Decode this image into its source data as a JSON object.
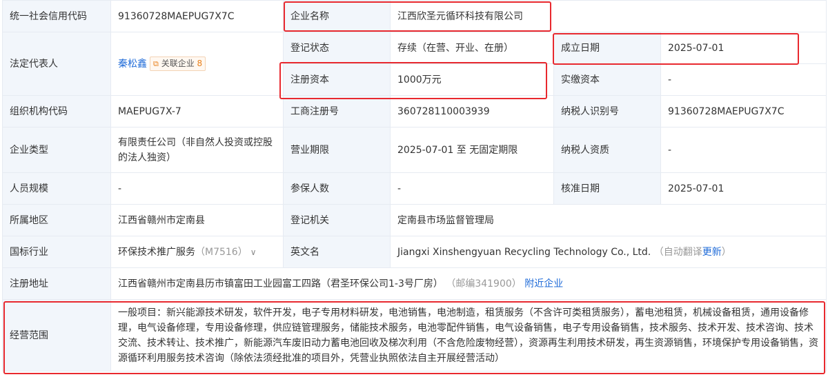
{
  "rows": {
    "credit_code": {
      "label": "统一社会信用代码",
      "value": "91360728MAEPUG7X7C"
    },
    "company_name": {
      "label": "企业名称",
      "value": "江西欣圣元循环科技有限公司"
    },
    "legal_rep": {
      "label": "法定代表人",
      "name": "秦松鑫",
      "tag_label": "关联企业",
      "tag_count": "8"
    },
    "reg_status": {
      "label": "登记状态",
      "value": "存续（在营、开业、在册）"
    },
    "est_date": {
      "label": "成立日期",
      "value": "2025-07-01"
    },
    "reg_capital": {
      "label": "注册资本",
      "value": "1000万元"
    },
    "paid_capital": {
      "label": "实缴资本",
      "value": "-"
    },
    "org_code": {
      "label": "组织机构代码",
      "value": "MAEPUG7X-7"
    },
    "biz_reg_no": {
      "label": "工商注册号",
      "value": "360728110003939"
    },
    "taxpayer_id": {
      "label": "纳税人识别号",
      "value": "91360728MAEPUG7X7C"
    },
    "company_type": {
      "label": "企业类型",
      "value": "有限责任公司（非自然人投资或控股的法人独资）"
    },
    "biz_term": {
      "label": "营业期限",
      "value": "2025-07-01 至 无固定期限"
    },
    "taxpayer_qual": {
      "label": "纳税人资质",
      "value": "-"
    },
    "staff_size": {
      "label": "人员规模",
      "value": "-"
    },
    "insured": {
      "label": "参保人数",
      "value": "-"
    },
    "approve_date": {
      "label": "核准日期",
      "value": "2025-07-01"
    },
    "region": {
      "label": "所属地区",
      "value": "江西省赣州市定南县"
    },
    "reg_authority": {
      "label": "登记机关",
      "value": "定南县市场监督管理局"
    },
    "industry": {
      "label": "国标行业",
      "value": "环保技术推广服务",
      "code": "（M7516）"
    },
    "english_name": {
      "label": "英文名",
      "value": "Jiangxi Xinshengyuan Recycling Technology Co., Ltd.",
      "note": "（自动翻译",
      "update": "更新",
      "close": "）"
    },
    "address": {
      "label": "注册地址",
      "value": "江西省赣州市定南县历市镇富田工业园富工四路（君圣环保公司1-3号厂房）",
      "postcode": "（邮编341900）",
      "nearby": "附近企业"
    },
    "scope": {
      "label": "经营范围",
      "value": "一般项目：新兴能源技术研发，软件开发，电子专用材料研发，电池销售，电池制造，租赁服务（不含许可类租赁服务），蓄电池租赁，机械设备租赁，通用设备修理，电气设备修理，专用设备修理，供应链管理服务，储能技术服务，电池零配件销售，电气设备销售，电子专用设备销售，技术服务、技术开发、技术咨询、技术交流、技术转让、技术推广，新能源汽车废旧动力蓄电池回收及梯次利用（不含危险废物经营），资源再生利用技术研发，再生资源销售，环境保护专用设备销售，资源循环利用服务技术咨询（除依法须经批准的项目外，凭营业执照依法自主开展经营活动）"
    }
  },
  "colors": {
    "highlight": "#e8282e",
    "link": "#1f6bd8",
    "label_bg": "#f2f6fb"
  }
}
